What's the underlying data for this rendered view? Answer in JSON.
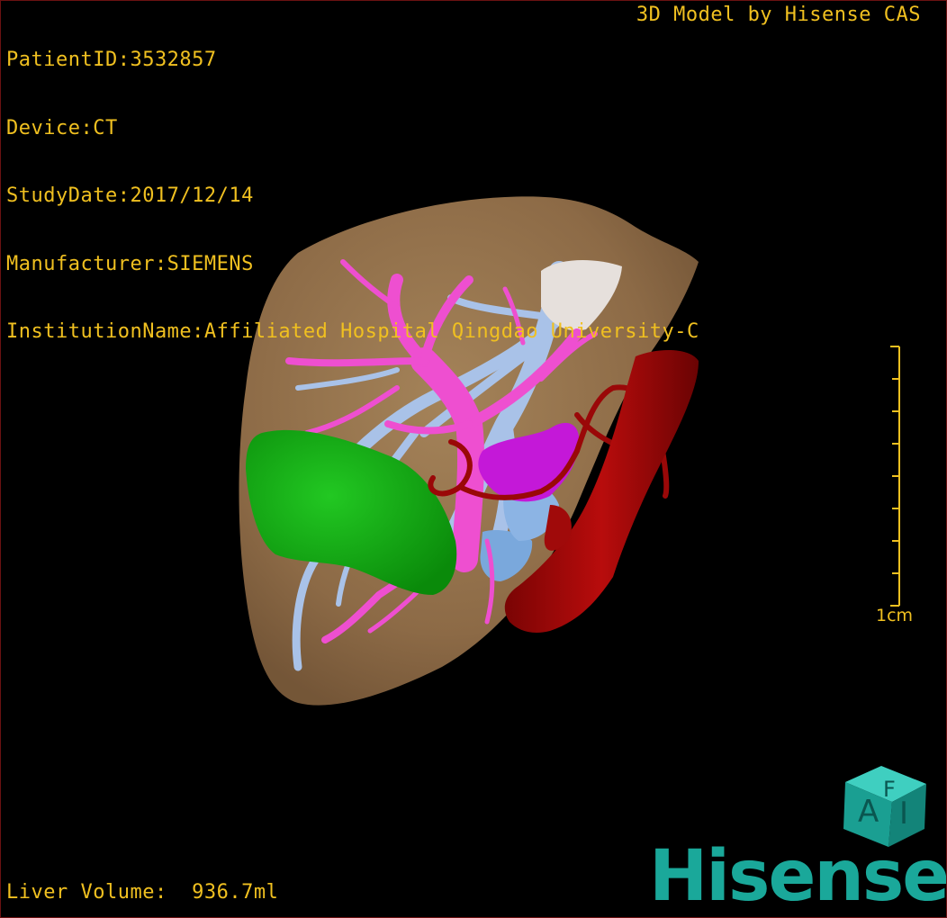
{
  "header": {
    "patient_id": "PatientID:3532857",
    "device": "Device:CT",
    "study_date": "StudyDate:2017/12/14",
    "manufacturer": "Manufacturer:SIEMENS",
    "institution": "InstitutionName:Affiliated Hospital Qingdao University-C"
  },
  "brand_caption": "3D Model by Hisense CAS",
  "scale": {
    "label": "1cm"
  },
  "readout": {
    "liver_volume": "Liver Volume:  936.7ml"
  },
  "logo": {
    "word": "Hisense",
    "cube_letters": [
      "A",
      "I",
      "F"
    ]
  },
  "colors": {
    "overlay_text": "#f0c020",
    "liver": "#a07c52",
    "tumor": "#13b013",
    "portal_vein": "#ee4fd0",
    "hepatic_vein": "#a9c2e8",
    "artery_ivc": "#a80808",
    "lesion": "#c418d8",
    "brand": "#1aa89a"
  }
}
